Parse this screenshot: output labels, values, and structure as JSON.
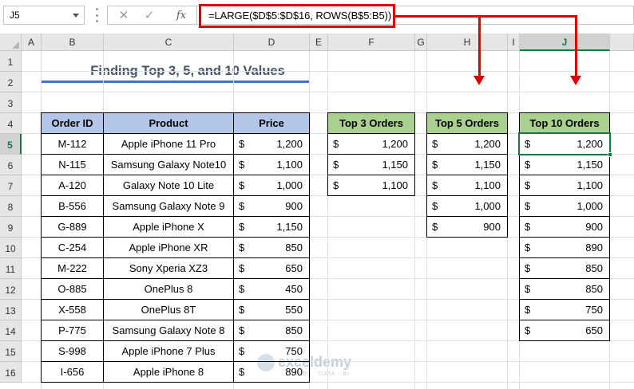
{
  "formula_bar": {
    "name_box": "J5",
    "cancel_icon": "✕",
    "enter_icon": "✓",
    "fx_label": "fx",
    "formula": "=LARGE($D$5:$D$16, ROWS(B$5:B5))"
  },
  "columns": [
    "A",
    "B",
    "C",
    "D",
    "E",
    "F",
    "G",
    "H",
    "I",
    "J"
  ],
  "rows": [
    "1",
    "2",
    "3",
    "4",
    "5",
    "6",
    "7",
    "8",
    "9",
    "10",
    "11",
    "12",
    "13",
    "14",
    "15",
    "16"
  ],
  "selected_cell": "J5",
  "title": "Finding Top 3, 5, and 10 Values",
  "main_table": {
    "headers": [
      "Order ID",
      "Product",
      "Price"
    ],
    "currency": "$",
    "rows": [
      {
        "id": "M-112",
        "product": "Apple iPhone 11 Pro",
        "price": "1,200"
      },
      {
        "id": "N-115",
        "product": "Samsung Galaxy Note10",
        "price": "1,100"
      },
      {
        "id": "A-120",
        "product": "Galaxy Note 10 Lite",
        "price": "1,000"
      },
      {
        "id": "B-556",
        "product": "Samsung Galaxy Note 9",
        "price": "900"
      },
      {
        "id": "G-889",
        "product": "Apple iPhone X",
        "price": "1,150"
      },
      {
        "id": "C-254",
        "product": "Apple iPhone XR",
        "price": "850"
      },
      {
        "id": "M-222",
        "product": "Sony Xperia XZ3",
        "price": "650"
      },
      {
        "id": "O-885",
        "product": "OnePlus 8",
        "price": "450"
      },
      {
        "id": "X-558",
        "product": "OnePlus 8T",
        "price": "550"
      },
      {
        "id": "P-775",
        "product": "Samsung Galaxy Note 8",
        "price": "850"
      },
      {
        "id": "S-998",
        "product": "Apple iPhone 7 Plus",
        "price": "750"
      },
      {
        "id": "I-656",
        "product": "Apple iPhone 8",
        "price": "890"
      }
    ]
  },
  "top3": {
    "header": "Top 3 Orders",
    "values": [
      "1,200",
      "1,150",
      "1,100"
    ]
  },
  "top5": {
    "header": "Top 5 Orders",
    "values": [
      "1,200",
      "1,150",
      "1,100",
      "1,000",
      "900"
    ]
  },
  "top10": {
    "header": "Top 10 Orders",
    "values": [
      "1,200",
      "1,150",
      "1,100",
      "1,000",
      "900",
      "890",
      "850",
      "850",
      "750",
      "650"
    ]
  },
  "watermark": {
    "name": "exceldemy",
    "tagline": "EXCEL · DATA · BI"
  },
  "colors": {
    "header_blue": "#b4c6e7",
    "header_green": "#a9d08e",
    "title": "#44546a",
    "underline": "#4472c4",
    "highlight_red": "#e00000",
    "excel_green": "#107c41"
  }
}
